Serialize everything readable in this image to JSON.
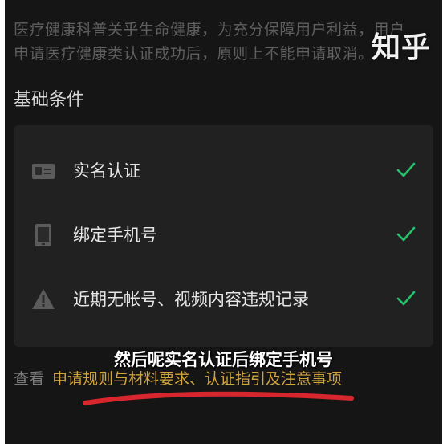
{
  "intro_text": "医疗健康科普关乎生命健康，为充分保障用户利益，用户申请医疗健康类认证成功后，原则上不能申请取消。",
  "watermark": "知乎",
  "section_title": "基础条件",
  "conditions": [
    {
      "label": "实名认证",
      "icon": "id-card-icon",
      "status": "check-icon"
    },
    {
      "label": "绑定手机号",
      "icon": "phone-icon",
      "status": "check-icon"
    },
    {
      "label": "近期无帐号、视频内容违规记录",
      "icon": "warning-icon",
      "status": "check-icon"
    }
  ],
  "footer": {
    "prefix": "查看",
    "link_rules": "申请规则与材料要求",
    "separator": "、",
    "link_guide": "认证指引及注意事项"
  },
  "subtitle": "然后呢实名认证后绑定手机号",
  "colors": {
    "background": "#151515",
    "card": "#212121",
    "check": "#25c26e",
    "link": "#d1a43c",
    "underline": "#d7262e"
  }
}
